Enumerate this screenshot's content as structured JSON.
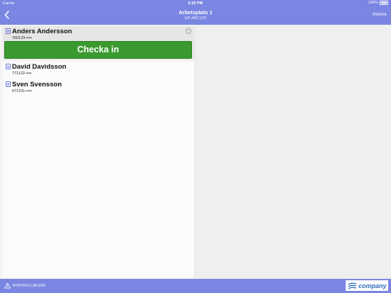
{
  "statusbar": {
    "carrier": "Carrier",
    "time": "6:25 PM",
    "battery": "100%"
  },
  "navbar": {
    "title": "Arbetsplats 1",
    "subtitle": "EP-ABC123",
    "edit_label": "ÄNDRA",
    "back_icon": "chevron-left-icon"
  },
  "selected": {
    "name": "Anders Andersson",
    "id": "760123-••••",
    "checkin_label": "Checka in",
    "info_icon": "info-icon"
  },
  "people": [
    {
      "name": "David Davidsson",
      "id": "771122-••••"
    },
    {
      "name": "Sven Svensson",
      "id": "671231-••••"
    }
  ],
  "bottombar": {
    "kontrollbesok_label": "KONTROLLBESÖK",
    "logo_text": "company"
  },
  "colors": {
    "bar": "#7b86e2",
    "checkin": "#3a9a2f",
    "logo_text": "#2f6fb8"
  }
}
